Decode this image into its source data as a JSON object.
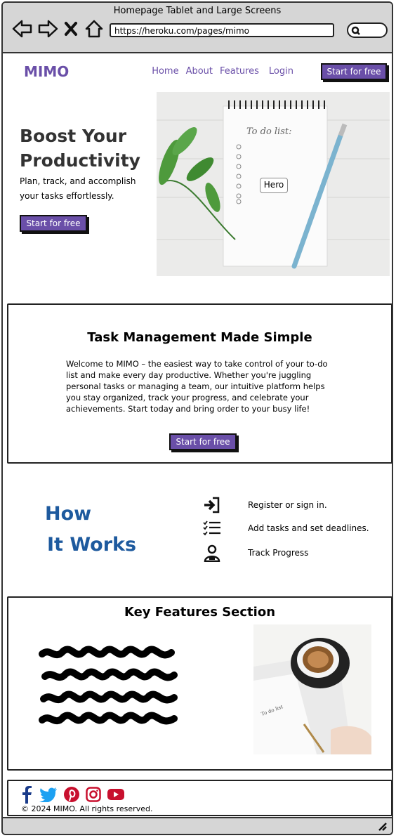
{
  "browser": {
    "window_title": "Homepage Tablet and Large Screens",
    "url": "https://heroku.com/pages/mimo",
    "icons": [
      "back-icon",
      "forward-icon",
      "close-icon",
      "home-icon",
      "search-icon"
    ]
  },
  "header": {
    "logo": "MIMO",
    "nav": [
      "Home",
      "About",
      "Features",
      "Login"
    ],
    "cta": "Start for free"
  },
  "hero": {
    "title_line1": "Boost Your",
    "title_line2": "Productivity",
    "subtitle": "Plan, track, and accomplish your tasks effortlessly.",
    "cta": "Start for free",
    "image_label": "Hero",
    "note_text": "To do list:"
  },
  "task_management": {
    "title": "Task Management Made Simple",
    "body": "Welcome to MIMO – the easiest way to take control of your to-do list and make every day productive. Whether you're juggling personal tasks or managing a team, our intuitive platform helps you stay organized, track your progress, and celebrate your achievements. Start today and bring order to your busy life!",
    "cta": "Start for free"
  },
  "how_it_works": {
    "title_line1": "How",
    "title_line2": "It Works",
    "steps": [
      {
        "icon": "sign-in-icon",
        "label": "Register or sign in."
      },
      {
        "icon": "task-list-icon",
        "label": "Add tasks and set deadlines."
      },
      {
        "icon": "user-progress-icon",
        "label": "Track Progress"
      }
    ]
  },
  "key_features": {
    "title": "Key Features Section"
  },
  "footer": {
    "social": [
      "facebook-icon",
      "twitter-icon",
      "pinterest-icon",
      "instagram-icon",
      "youtube-icon"
    ],
    "copyright": "© 2024 MIMO. All rights reserved."
  },
  "colors": {
    "brand": "#6a4fa8",
    "heading_blue": "#1e5a9e",
    "chrome": "#d6d6d6"
  }
}
